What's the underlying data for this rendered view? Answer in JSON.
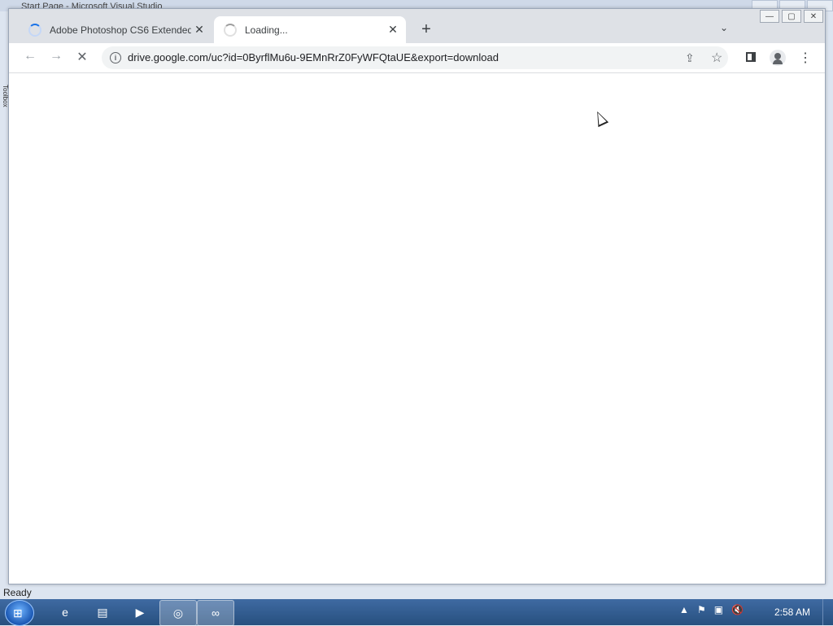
{
  "background_window": {
    "title": "Start Page - Microsoft Visual Studio",
    "toolbox_label": "Toolbox",
    "status_text": "Ready"
  },
  "browser": {
    "tabs": [
      {
        "title": "Adobe Photoshop CS6 Extended",
        "state": "loading"
      },
      {
        "title": "Loading...",
        "state": "loading",
        "active": true
      }
    ],
    "new_tab_label": "+",
    "tab_search_label": "⌄",
    "window_controls": {
      "minimize": "—",
      "maximize": "▢",
      "close": "✕"
    },
    "toolbar": {
      "back": "←",
      "forward": "→",
      "stop": "✕",
      "url": "drive.google.com/uc?id=0ByrflMu6u-9EMnRrZ0FyWFQtaUE&export=download",
      "share": "⇪",
      "star": "☆",
      "menu": "⋮"
    }
  },
  "taskbar": {
    "start_label": "⊞",
    "items": [
      {
        "name": "ie",
        "glyph": "e"
      },
      {
        "name": "explorer",
        "glyph": "▤"
      },
      {
        "name": "media",
        "glyph": "▶"
      },
      {
        "name": "chrome",
        "glyph": "◎"
      },
      {
        "name": "visual-studio",
        "glyph": "∞"
      }
    ],
    "tray_icons": [
      "▲",
      "⚑",
      "▣",
      "🔇"
    ],
    "clock": "2:58 AM"
  },
  "colors": {
    "accent": "#1a73e8",
    "tabstrip": "#dee1e6",
    "taskbar": "#27507f"
  }
}
